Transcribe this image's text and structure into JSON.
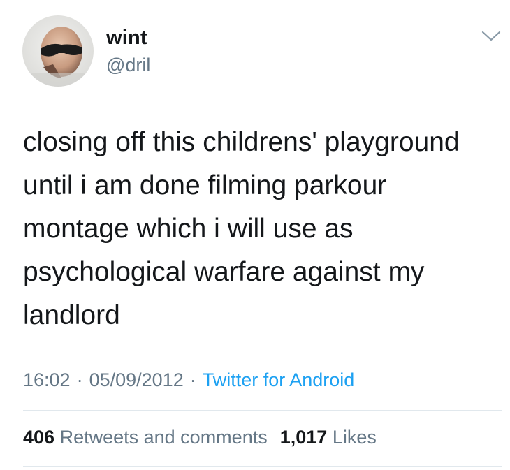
{
  "author": {
    "display_name": "wint",
    "handle": "@dril",
    "avatar_icon": "user-avatar-photo"
  },
  "menu_icon": "chevron-down-icon",
  "tweet": {
    "text": "closing off this childrens' playground\nuntil i am done filming parkour\nmontage which i will use as\npsychological warfare against my\nlandlord"
  },
  "meta": {
    "time": "16:02",
    "date": "05/09/2012",
    "separator": "·",
    "source": "Twitter for Android"
  },
  "stats": {
    "retweets_count": "406",
    "retweets_label": "Retweets and comments",
    "likes_count": "1,017",
    "likes_label": "Likes"
  },
  "colors": {
    "text": "#14171a",
    "secondary": "#657786",
    "link": "#1da1f2",
    "divider": "#e1e8ed"
  }
}
